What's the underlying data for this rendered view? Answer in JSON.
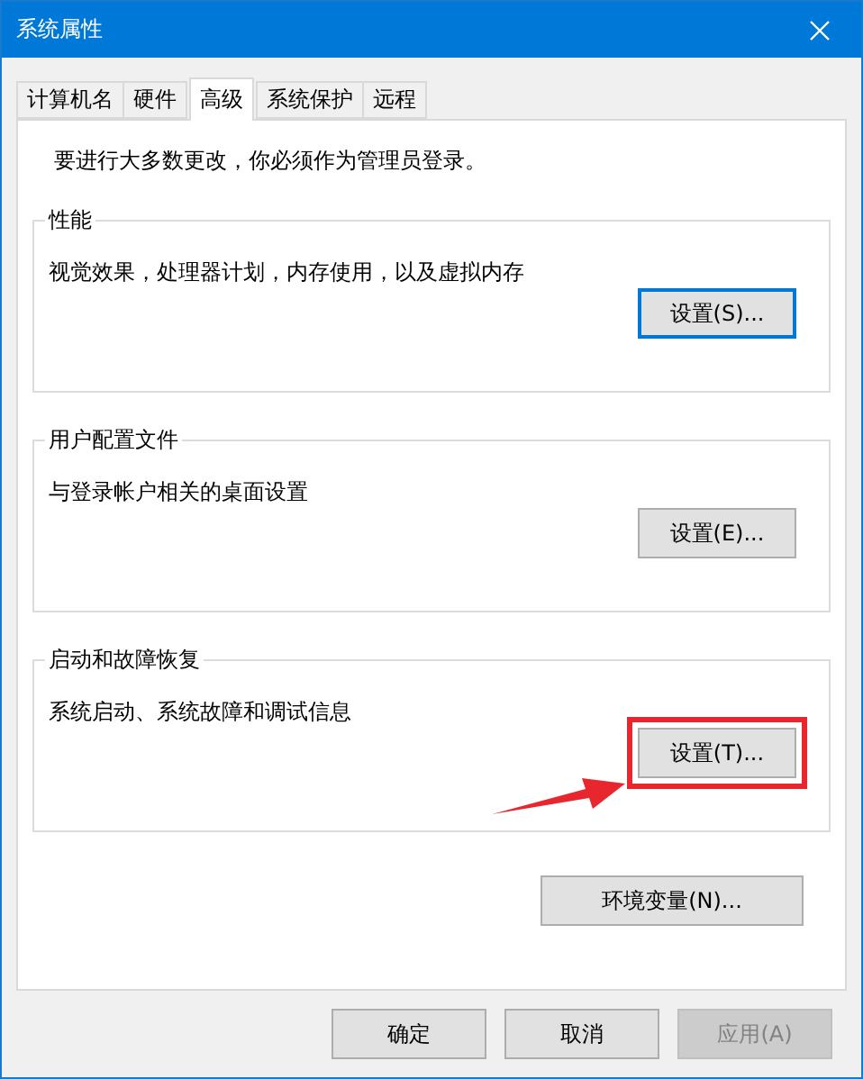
{
  "window": {
    "title": "系统属性"
  },
  "tabs": [
    {
      "label": "计算机名",
      "selected": false
    },
    {
      "label": "硬件",
      "selected": false
    },
    {
      "label": "高级",
      "selected": true
    },
    {
      "label": "系统保护",
      "selected": false
    },
    {
      "label": "远程",
      "selected": false
    }
  ],
  "notice": "要进行大多数更改，你必须作为管理员登录。",
  "groups": [
    {
      "title": "性能",
      "description": "视觉效果，处理器计划，内存使用，以及虚拟内存",
      "button": {
        "label": "设置(S)...",
        "focused": true,
        "highlighted": false
      }
    },
    {
      "title": "用户配置文件",
      "description": "与登录帐户相关的桌面设置",
      "button": {
        "label": "设置(E)...",
        "focused": false,
        "highlighted": false
      }
    },
    {
      "title": "启动和故障恢复",
      "description": "系统启动、系统故障和调试信息",
      "button": {
        "label": "设置(T)...",
        "focused": false,
        "highlighted": true
      }
    }
  ],
  "env_button": "环境变量(N)...",
  "buttons": [
    {
      "label": "确定",
      "disabled": false
    },
    {
      "label": "取消",
      "disabled": false
    },
    {
      "label": "应用(A)",
      "disabled": true
    }
  ]
}
